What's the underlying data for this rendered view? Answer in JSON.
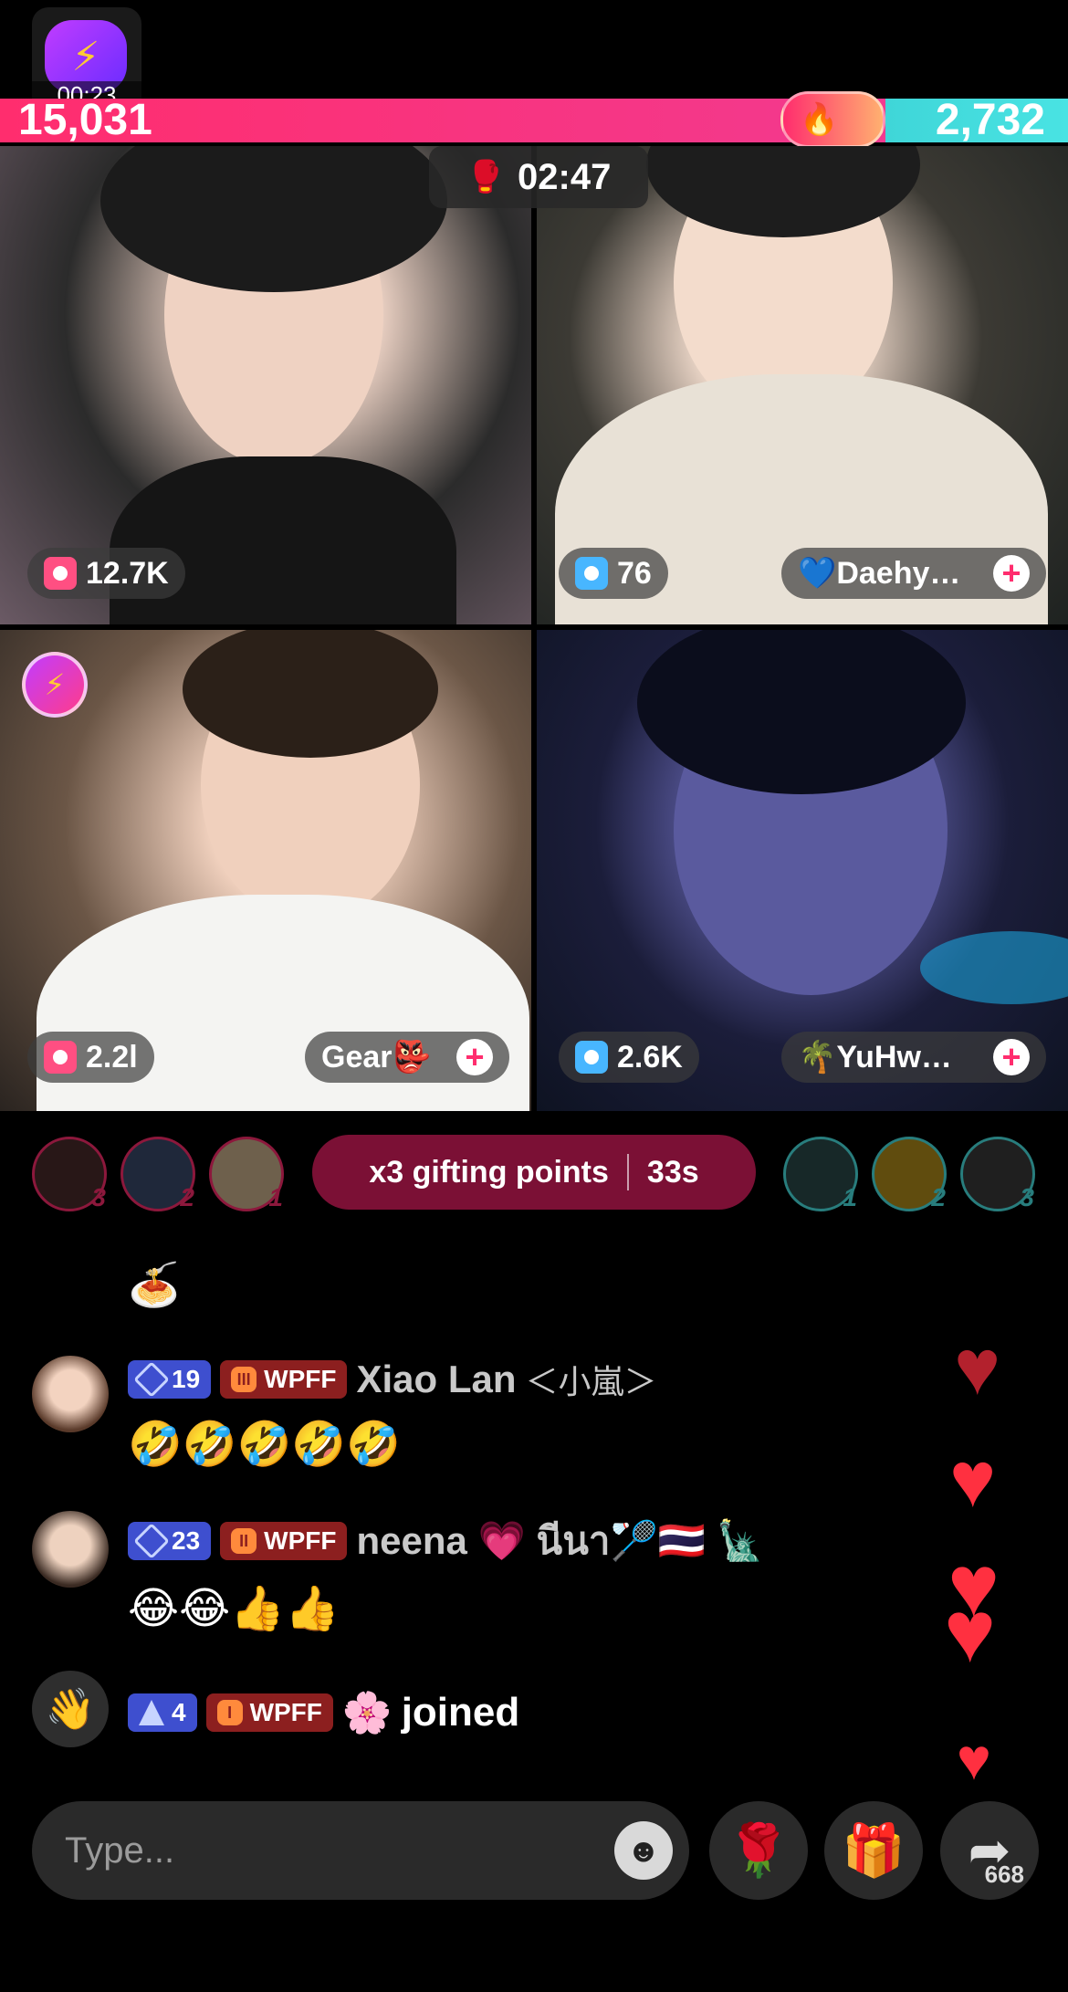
{
  "battle": {
    "live_timer": "00:23",
    "score_left": "15,031",
    "score_right": "2,732",
    "countdown": "02:47"
  },
  "players": [
    {
      "gift_count": "12.7K",
      "name": ""
    },
    {
      "gift_count": "76",
      "name": "💙Daehy…"
    },
    {
      "gift_count": "2.2l",
      "name": "Gear👺"
    },
    {
      "gift_count": "2.6K",
      "name": "🌴YuHw…"
    }
  ],
  "gifting": {
    "label": "x3 gifting points",
    "time_left": "33s",
    "left_ranks": [
      "3",
      "2",
      "1"
    ],
    "right_ranks": [
      "1",
      "2",
      "3"
    ]
  },
  "chat": [
    {
      "type": "emoji_only",
      "text": "🍝"
    },
    {
      "level": "19",
      "fan_badge": "WPFF",
      "fan_level": "III",
      "username": "Xiao Lan",
      "username_sub": "＜小嵐＞",
      "message": "🤣🤣🤣🤣🤣"
    },
    {
      "level": "23",
      "fan_badge": "WPFF",
      "fan_level": "II",
      "username": "neena 💗 นีนา🏸🇹🇭 🗽",
      "message": "😂😂👍👍"
    },
    {
      "level": "4",
      "fan_badge": "WPFF",
      "fan_level": "I",
      "username": "🌸",
      "message": "joined"
    }
  ],
  "input": {
    "placeholder": "Type..."
  },
  "actions": {
    "share_count": "668",
    "rose": "🌹",
    "gift": "🎁",
    "share": "➦"
  },
  "colors": {
    "red_team": "#ff2d6e",
    "blue_team": "#49e3e3",
    "heart": "#ff3040"
  }
}
